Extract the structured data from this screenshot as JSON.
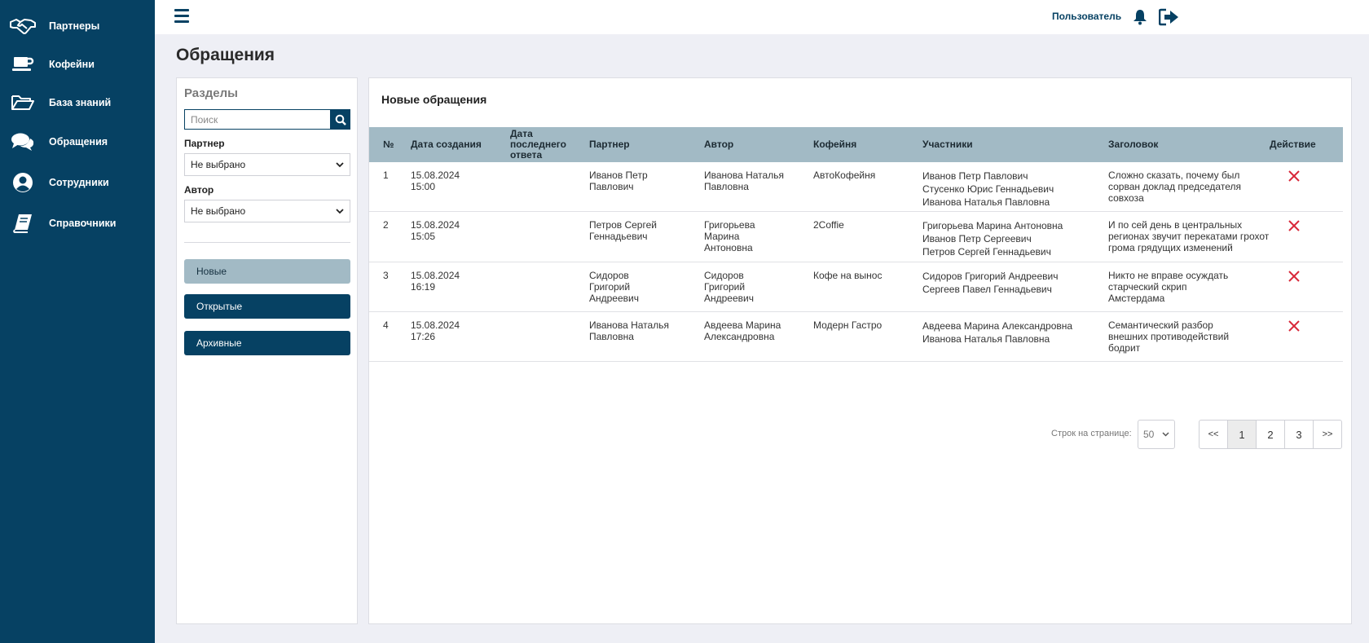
{
  "sidebar": {
    "items": [
      {
        "label": "Партнеры",
        "icon": "handshake-icon"
      },
      {
        "label": "Кофейни",
        "icon": "coffee-cup-icon"
      },
      {
        "label": "База знаний",
        "icon": "folder-open-icon"
      },
      {
        "label": "Обращения",
        "icon": "chat-bubbles-icon"
      },
      {
        "label": "Сотрудники",
        "icon": "user-circle-icon"
      },
      {
        "label": "Справочники",
        "icon": "book-icon"
      }
    ]
  },
  "header": {
    "user_label": "Пользователь"
  },
  "page": {
    "title": "Обращения"
  },
  "filters": {
    "title": "Разделы",
    "search_placeholder": "Поиск",
    "partner_label": "Партнер",
    "partner_value": "Не выбрано",
    "author_label": "Автор",
    "author_value": "Не выбрано",
    "buttons": [
      "Новые",
      "Открытые",
      "Архивные"
    ]
  },
  "table": {
    "title": "Новые обращения",
    "headers": {
      "num": "№",
      "created": "Дата создания",
      "last_reply": "Дата последнего ответа",
      "partner": "Партнер",
      "author": "Автор",
      "coffee": "Кофейня",
      "participants": "Участники",
      "subject": "Заголовок",
      "action": "Действие"
    },
    "rows": [
      {
        "num": "1",
        "created": "15.08.2024 15:00",
        "last_reply": "",
        "partner": "Иванов Петр Павлович",
        "author": "Иванова Наталья Павловна",
        "coffee": "АвтоКофейня",
        "participants": [
          "Иванов Петр Павлович",
          "Стусенко Юрис Геннадьевич",
          "Иванова Наталья Павловна"
        ],
        "subject": "Сложно сказать, почему был сорван доклад председателя совхоза"
      },
      {
        "num": "2",
        "created": "15.08.2024 15:05",
        "last_reply": "",
        "partner": "Петров Сергей Геннадьевич",
        "author": "Григорьева Марина Антоновна",
        "coffee": "2Coffie",
        "participants": [
          "Григорьева Марина Антоновна",
          "Иванов Петр Сергеевич",
          "Петров Сергей Геннадьевич"
        ],
        "subject": "И по сей день в центральных регионах звучит перекатами грохот грома грядущих изменений"
      },
      {
        "num": "3",
        "created": "15.08.2024 16:19",
        "last_reply": "",
        "partner": "Сидоров Григорий Андреевич",
        "author": "Сидоров Григорий Андреевич",
        "coffee": "Кофе на вынос",
        "participants": [
          "Сидоров Григорий Андреевич",
          "Сергеев Павел Геннадьевич"
        ],
        "subject": "Никто не вправе осуждать старческий скрип Амстердама"
      },
      {
        "num": "4",
        "created": "15.08.2024 17:26",
        "last_reply": "",
        "partner": "Иванова Наталья Павловна",
        "author": "Авдеева Марина Александровна",
        "coffee": "Модерн Гастро",
        "participants": [
          "Авдеева Марина Александровна",
          "Иванова Наталья Павловна"
        ],
        "subject": "Семантический разбор внешних противодействий бодрит"
      }
    ]
  },
  "pagination": {
    "rows_label": "Строк на странице:",
    "rows_value": "50",
    "prev": "<<",
    "pages": [
      "1",
      "2",
      "3"
    ],
    "current": "1",
    "next": ">>"
  },
  "colors": {
    "sidebar_bg": "#064163",
    "header_row_bg": "#a2bac5",
    "delete_icon": "#d9293a"
  }
}
